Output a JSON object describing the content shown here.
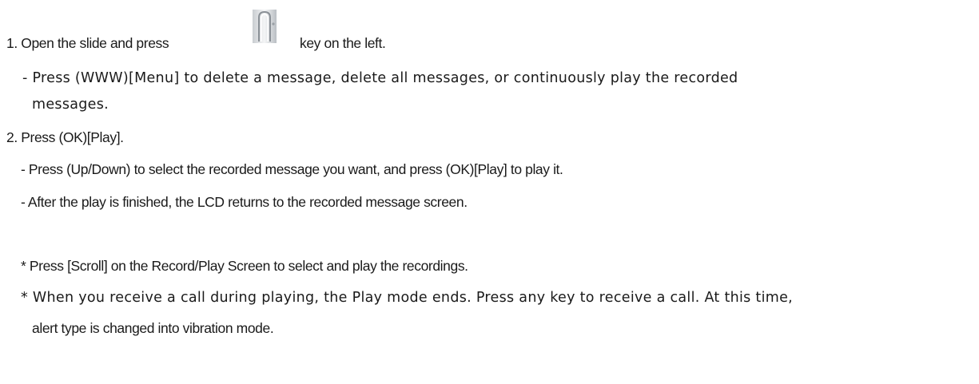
{
  "step1": {
    "prefix": "1. Open the slide and press",
    "key_icon": "side-key-icon",
    "suffix": "key on the left."
  },
  "step1_note": {
    "line1": "- Press (WWW)[Menu] to delete a message, delete all messages, or continuously play the recorded",
    "line2": "messages."
  },
  "step2": {
    "text": "2. Press (OK)[Play]."
  },
  "step2_notes": [
    "- Press (Up/Down) to select the recorded message you want, and press (OK)[Play] to play it.",
    "- After the play is finished, the LCD returns to the recorded message screen."
  ],
  "tips": {
    "tip1": "* Press [Scroll] on the Record/Play Screen to select and play the recordings.",
    "tip2_line1": "* When you receive a call during playing, the Play mode ends. Press any key to receive a call. At this time,",
    "tip2_line2": "alert type is changed into vibration mode."
  }
}
